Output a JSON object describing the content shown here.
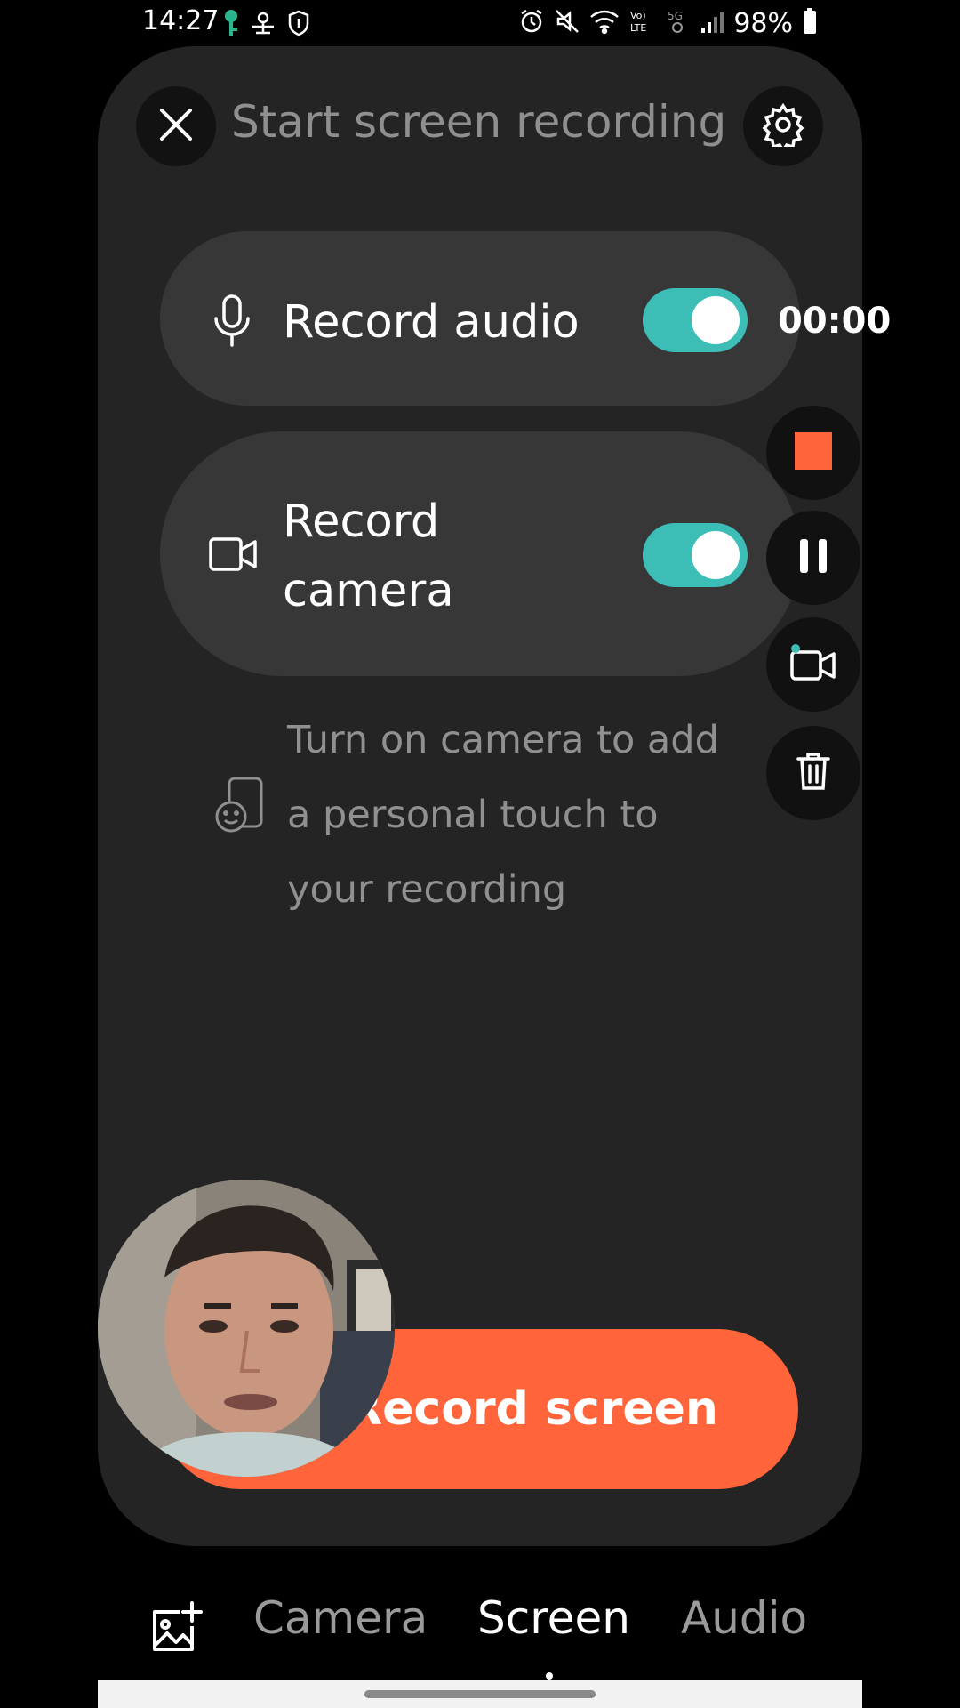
{
  "status_bar": {
    "time": "14:27",
    "battery": "98%",
    "icons": [
      "key-icon",
      "network-icon",
      "shield-icon",
      "alarm-icon",
      "mute-icon",
      "wifi-icon",
      "volte-icon",
      "5g-icon",
      "signal-icon",
      "battery-icon"
    ]
  },
  "header": {
    "title": "Start screen recording",
    "close_icon": "close-icon",
    "settings_icon": "gear-icon"
  },
  "options": [
    {
      "label": "Record audio",
      "icon": "microphone-icon",
      "enabled": true
    },
    {
      "label": "Record camera",
      "icon": "video-camera-icon",
      "enabled": true
    }
  ],
  "hint": {
    "text": "Turn on camera to add a personal touch to your recording",
    "icon": "selfie-icon"
  },
  "recording_controls": {
    "timer": "00:00",
    "buttons": [
      "stop-icon",
      "pause-icon",
      "camera-toggle-icon",
      "trash-icon"
    ],
    "stop_color": "#ff643a"
  },
  "record_button": {
    "label": "Record screen",
    "color": "#ff643a"
  },
  "tabs": [
    {
      "label": "Camera",
      "active": false
    },
    {
      "label": "Screen",
      "active": true
    },
    {
      "label": "Audio",
      "active": false
    }
  ],
  "colors": {
    "accent": "#3cbdb6",
    "panel": "#242424",
    "pill": "#373737"
  }
}
